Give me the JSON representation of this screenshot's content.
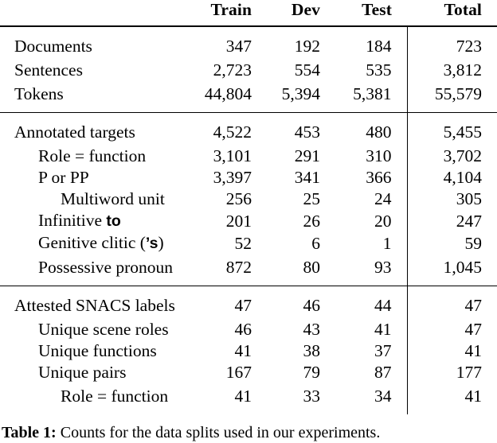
{
  "table": {
    "columns": [
      "",
      "Train",
      "Dev",
      "Test",
      "Total"
    ],
    "header": {
      "label": "",
      "train": "Train",
      "dev": "Dev",
      "test": "Test",
      "total": "Total"
    },
    "sections": [
      {
        "rows": [
          {
            "label": "Documents",
            "indent": 0,
            "train": "347",
            "dev": "192",
            "test": "184",
            "total": "723"
          },
          {
            "label": "Sentences",
            "indent": 0,
            "train": "2,723",
            "dev": "554",
            "test": "535",
            "total": "3,812"
          },
          {
            "label": "Tokens",
            "indent": 0,
            "train": "44,804",
            "dev": "5,394",
            "test": "5,381",
            "total": "55,579"
          }
        ]
      },
      {
        "rows": [
          {
            "label": "Annotated targets",
            "indent": 0,
            "train": "4,522",
            "dev": "453",
            "test": "480",
            "total": "5,455"
          },
          {
            "label": "Role = function",
            "indent": 1,
            "train": "3,101",
            "dev": "291",
            "test": "310",
            "total": "3,702"
          },
          {
            "label": "P or PP",
            "indent": 1,
            "train": "3,397",
            "dev": "341",
            "test": "366",
            "total": "4,104"
          },
          {
            "label": "Multiword unit",
            "indent": 2,
            "train": "256",
            "dev": "25",
            "test": "24",
            "total": "305"
          },
          {
            "label_prefix": "Infinitive ",
            "label_emph": "to",
            "label_suffix": "",
            "indent": 1,
            "train": "201",
            "dev": "26",
            "test": "20",
            "total": "247"
          },
          {
            "label_prefix": "Genitive clitic (",
            "label_emph": "’s",
            "label_suffix": ")",
            "indent": 1,
            "train": "52",
            "dev": "6",
            "test": "1",
            "total": "59"
          },
          {
            "label": "Possessive pronoun",
            "indent": 1,
            "train": "872",
            "dev": "80",
            "test": "93",
            "total": "1,045"
          }
        ]
      },
      {
        "rows": [
          {
            "label": "Attested SNACS labels",
            "indent": 0,
            "train": "47",
            "dev": "46",
            "test": "44",
            "total": "47"
          },
          {
            "label": "Unique scene roles",
            "indent": 1,
            "train": "46",
            "dev": "43",
            "test": "41",
            "total": "47"
          },
          {
            "label": "Unique functions",
            "indent": 1,
            "train": "41",
            "dev": "38",
            "test": "37",
            "total": "41"
          },
          {
            "label": "Unique pairs",
            "indent": 1,
            "train": "167",
            "dev": "79",
            "test": "87",
            "total": "177"
          },
          {
            "label": "Role = function",
            "indent": 2,
            "train": "41",
            "dev": "33",
            "test": "34",
            "total": "41"
          }
        ]
      }
    ]
  },
  "caption": {
    "label": "Table 1:",
    "text": " Counts for the data splits used in our experiments."
  }
}
